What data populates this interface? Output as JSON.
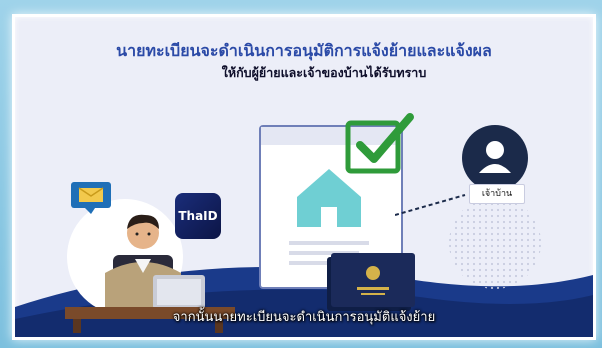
{
  "title": {
    "line1": "นายทะเบียนจะดำเนินการอนุมัติการแจ้งย้ายและแจ้งผล",
    "line2": "ให้กับผู้ย้ายและเจ้าของบ้านได้รับทราบ"
  },
  "subtitle": "จากนั้นนายทะเบียนจะดำเนินการอนุมัติแจ้งย้าย",
  "thaid_logo_text": "ThaID",
  "homeowner_label": "เจ้าบ้าน",
  "colors": {
    "title_blue": "#2b4aa7",
    "check_green": "#2f9b3a",
    "navy": "#1b2a4a",
    "wave_blue": "#1a3a8a",
    "house_teal": "#6fcfd3"
  }
}
